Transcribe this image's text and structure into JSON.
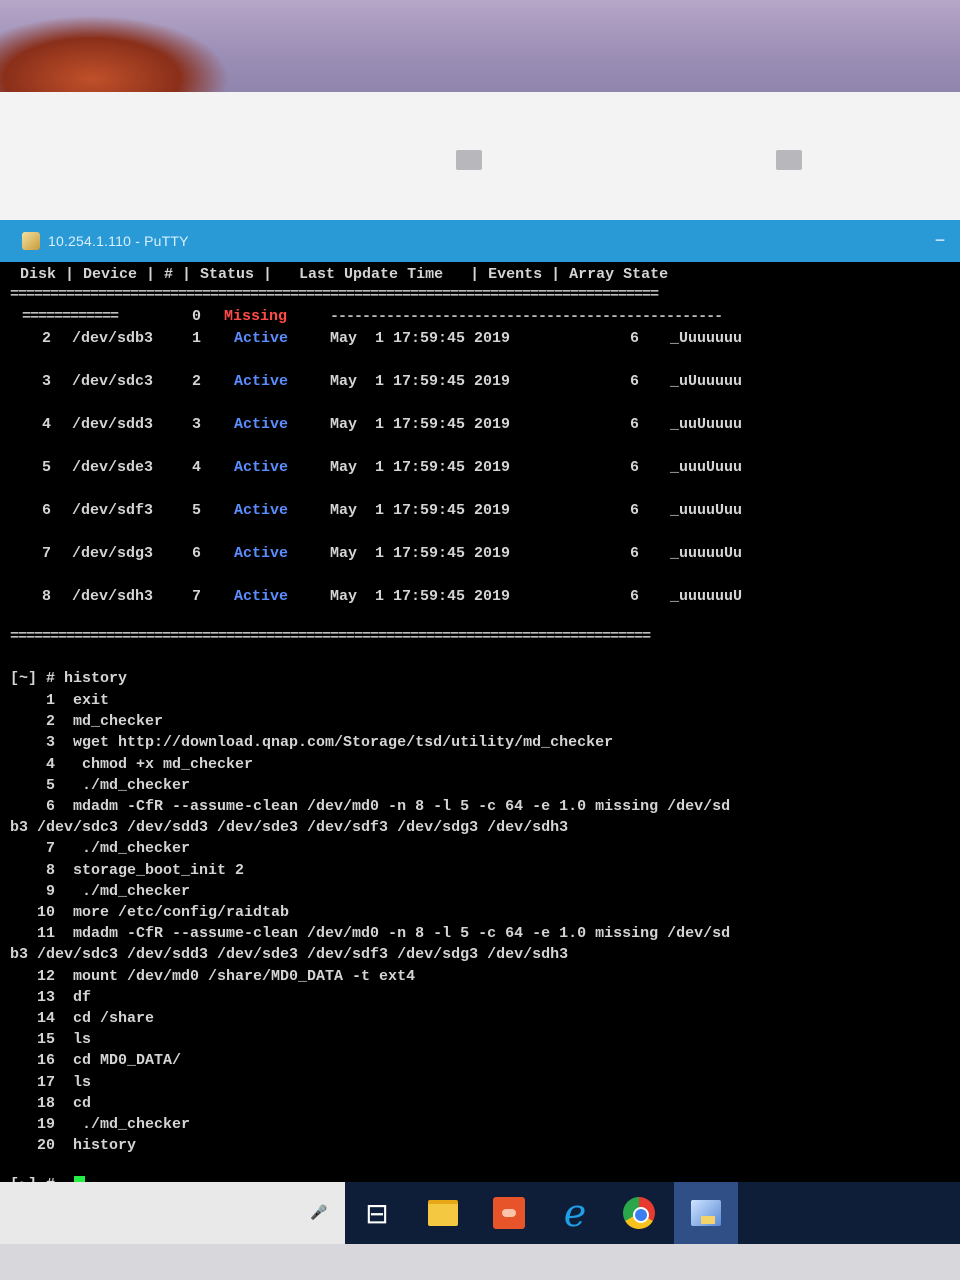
{
  "window": {
    "title": "10.254.1.110 - PuTTY"
  },
  "header": {
    "columns_line": "Disk | Device | # | Status |   Last Update Time   | Events | Array State",
    "separator": "================================================================================="
  },
  "missing_row": {
    "dashes_left": "============",
    "num": "0",
    "status": "Missing",
    "dashes_right": "-------------------------------------------------"
  },
  "disks": [
    {
      "disk": "2",
      "device": "/dev/sdb3",
      "num": "1",
      "status": "Active",
      "time": "May  1 17:59:45 2019",
      "events": "6",
      "array_state": "_Uuuuuuu"
    },
    {
      "disk": "3",
      "device": "/dev/sdc3",
      "num": "2",
      "status": "Active",
      "time": "May  1 17:59:45 2019",
      "events": "6",
      "array_state": "_uUuuuuu"
    },
    {
      "disk": "4",
      "device": "/dev/sdd3",
      "num": "3",
      "status": "Active",
      "time": "May  1 17:59:45 2019",
      "events": "6",
      "array_state": "_uuUuuuu"
    },
    {
      "disk": "5",
      "device": "/dev/sde3",
      "num": "4",
      "status": "Active",
      "time": "May  1 17:59:45 2019",
      "events": "6",
      "array_state": "_uuuUuuu"
    },
    {
      "disk": "6",
      "device": "/dev/sdf3",
      "num": "5",
      "status": "Active",
      "time": "May  1 17:59:45 2019",
      "events": "6",
      "array_state": "_uuuuUuu"
    },
    {
      "disk": "7",
      "device": "/dev/sdg3",
      "num": "6",
      "status": "Active",
      "time": "May  1 17:59:45 2019",
      "events": "6",
      "array_state": "_uuuuuUu"
    },
    {
      "disk": "8",
      "device": "/dev/sdh3",
      "num": "7",
      "status": "Active",
      "time": "May  1 17:59:45 2019",
      "events": "6",
      "array_state": "_uuuuuuU"
    }
  ],
  "footer_separator": "================================================================================",
  "history": {
    "prompt": "[~] # history",
    "lines": [
      "    1  exit",
      "    2  md_checker",
      "    3  wget http://download.qnap.com/Storage/tsd/utility/md_checker",
      "    4   chmod +x md_checker",
      "    5   ./md_checker",
      "    6  mdadm -CfR --assume-clean /dev/md0 -n 8 -l 5 -c 64 -e 1.0 missing /dev/sd",
      "b3 /dev/sdc3 /dev/sdd3 /dev/sde3 /dev/sdf3 /dev/sdg3 /dev/sdh3",
      "    7   ./md_checker",
      "    8  storage_boot_init 2",
      "    9   ./md_checker",
      "   10  more /etc/config/raidtab",
      "   11  mdadm -CfR --assume-clean /dev/md0 -n 8 -l 5 -c 64 -e 1.0 missing /dev/sd",
      "b3 /dev/sdc3 /dev/sdd3 /dev/sde3 /dev/sdf3 /dev/sdg3 /dev/sdh3",
      "   12  mount /dev/md0 /share/MD0_DATA -t ext4",
      "   13  df",
      "   14  cd /share",
      "   15  ls",
      "   16  cd MD0_DATA/",
      "   17  ls",
      "   18  cd",
      "   19   ./md_checker",
      "   20  history"
    ],
    "final_prompt": "[~] #"
  },
  "icons": {
    "title": "putty-icon",
    "task_view": "task-view-icon",
    "explorer": "folder-icon",
    "app": "orange-app-icon",
    "ie": "internet-explorer-icon",
    "chrome": "chrome-icon",
    "putty_taskbar": "putty-icon"
  },
  "colors": {
    "titlebar": "#2a9ad6",
    "missing": "#ff4a4a",
    "active": "#5b8dff",
    "cursor": "#22ee44",
    "taskbar": "#0e1e38"
  }
}
